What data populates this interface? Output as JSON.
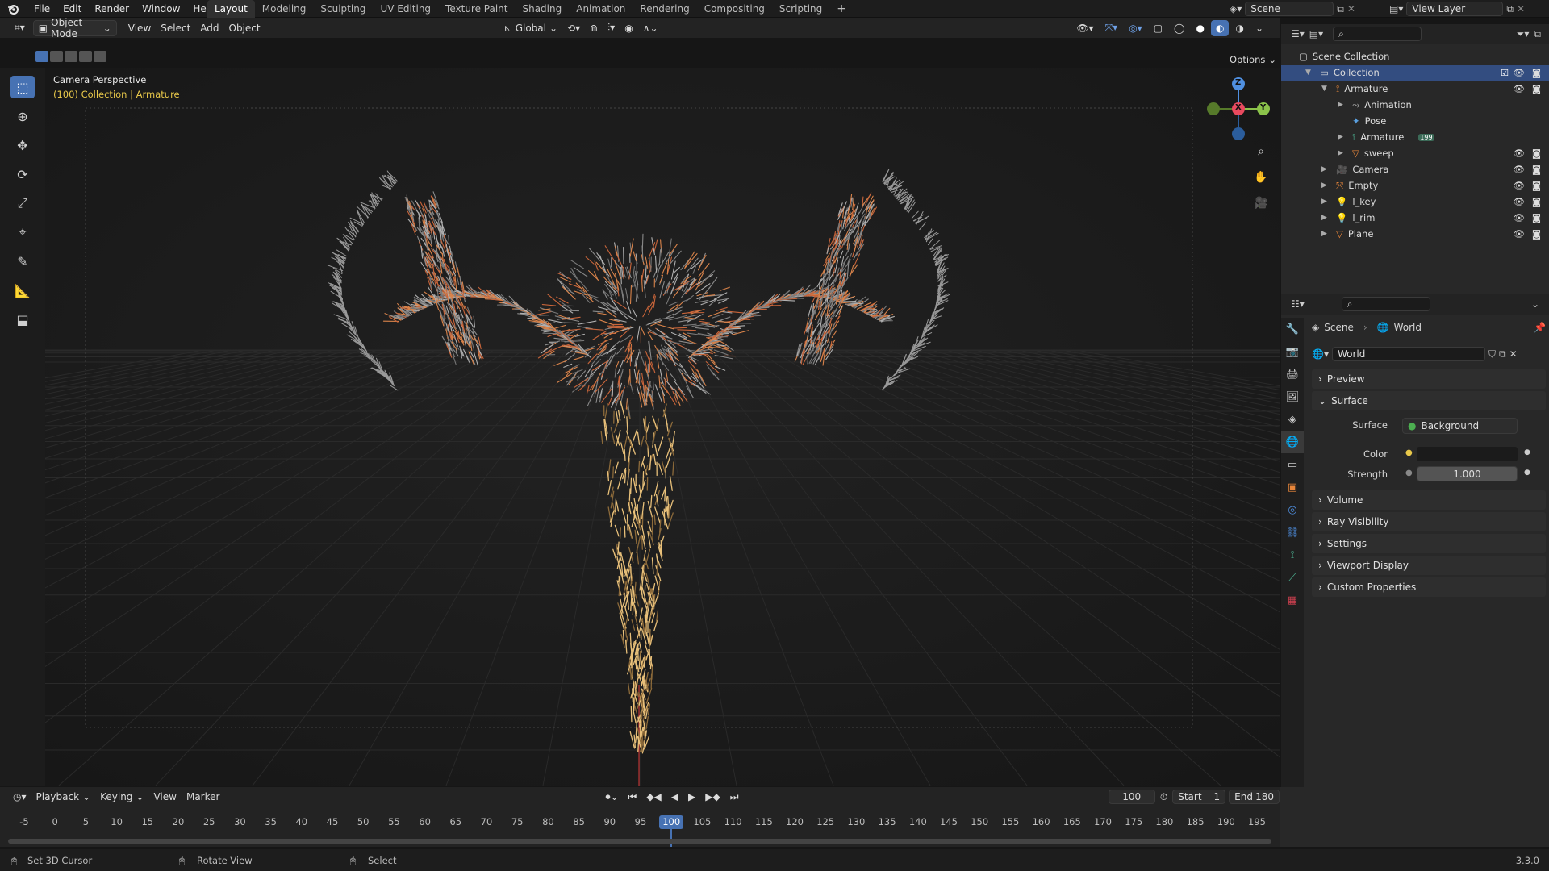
{
  "menubar": {
    "items": [
      "File",
      "Edit",
      "Render",
      "Window",
      "Help"
    ],
    "workspaces": [
      "Layout",
      "Modeling",
      "Sculpting",
      "UV Editing",
      "Texture Paint",
      "Shading",
      "Animation",
      "Rendering",
      "Compositing",
      "Scripting"
    ],
    "active_workspace": "Layout",
    "add_tab": "+",
    "scene_label": "Scene",
    "view_layer_label": "View Layer"
  },
  "viewport_header": {
    "mode": "Object Mode",
    "menus": [
      "View",
      "Select",
      "Add",
      "Object"
    ],
    "orientation": "Global",
    "options_label": "Options"
  },
  "viewport": {
    "camera_label": "Camera Perspective",
    "context_label": "(100) Collection | Armature",
    "gizmo": {
      "x": "X",
      "y": "Y",
      "z": "Z"
    }
  },
  "outliner": {
    "root": "Scene Collection",
    "items": [
      {
        "label": "Collection",
        "icon": "collection-icon",
        "depth": 1,
        "expanded": true,
        "selected": true
      },
      {
        "label": "Armature",
        "icon": "armature-icon",
        "depth": 2,
        "expanded": true
      },
      {
        "label": "Animation",
        "icon": "action-icon",
        "depth": 3
      },
      {
        "label": "Pose",
        "icon": "pose-icon",
        "depth": 3
      },
      {
        "label": "Armature",
        "icon": "armature-data-icon",
        "depth": 3,
        "badge": "199"
      },
      {
        "label": "sweep",
        "icon": "mesh-icon",
        "depth": 3
      },
      {
        "label": "Camera",
        "icon": "camera-icon",
        "depth": 2
      },
      {
        "label": "Empty",
        "icon": "empty-icon",
        "depth": 2
      },
      {
        "label": "l_key",
        "icon": "light-icon",
        "depth": 2
      },
      {
        "label": "l_rim",
        "icon": "light-icon",
        "depth": 2
      },
      {
        "label": "Plane",
        "icon": "mesh-icon",
        "depth": 2
      }
    ]
  },
  "properties": {
    "breadcrumb": [
      "Scene",
      "World"
    ],
    "world_name": "World",
    "panels": {
      "preview": "Preview",
      "surface": "Surface",
      "volume": "Volume",
      "ray_visibility": "Ray Visibility",
      "settings": "Settings",
      "viewport_display": "Viewport Display",
      "custom_properties": "Custom Properties"
    },
    "surface_label": "Surface",
    "surface_value": "Background",
    "color_label": "Color",
    "strength_label": "Strength",
    "strength_value": "1.000"
  },
  "timeline": {
    "menus": [
      "Playback",
      "Keying",
      "View",
      "Marker"
    ],
    "current_frame": "100",
    "start_label": "Start",
    "start_value": "1",
    "end_label": "End",
    "end_value": "180",
    "ticks": [
      "-5",
      "0",
      "5",
      "10",
      "15",
      "20",
      "25",
      "30",
      "35",
      "40",
      "45",
      "50",
      "55",
      "60",
      "65",
      "70",
      "75",
      "80",
      "85",
      "90",
      "95",
      "100",
      "105",
      "110",
      "115",
      "120",
      "125",
      "130",
      "135",
      "140",
      "145",
      "150",
      "155",
      "160",
      "165",
      "170",
      "175",
      "180",
      "185",
      "190",
      "195"
    ]
  },
  "statusbar": {
    "left": "Set 3D Cursor",
    "middle": "Rotate View",
    "right": "Select",
    "version": "3.3.0"
  },
  "colors": {
    "accent": "#4772b3",
    "selection": "#334d80",
    "active_frame": "#4772b3",
    "armature_orange": "#e8863a",
    "x_axis": "#e84a5f",
    "y_axis": "#8bc34a",
    "z_axis": "#4f8fe0"
  }
}
